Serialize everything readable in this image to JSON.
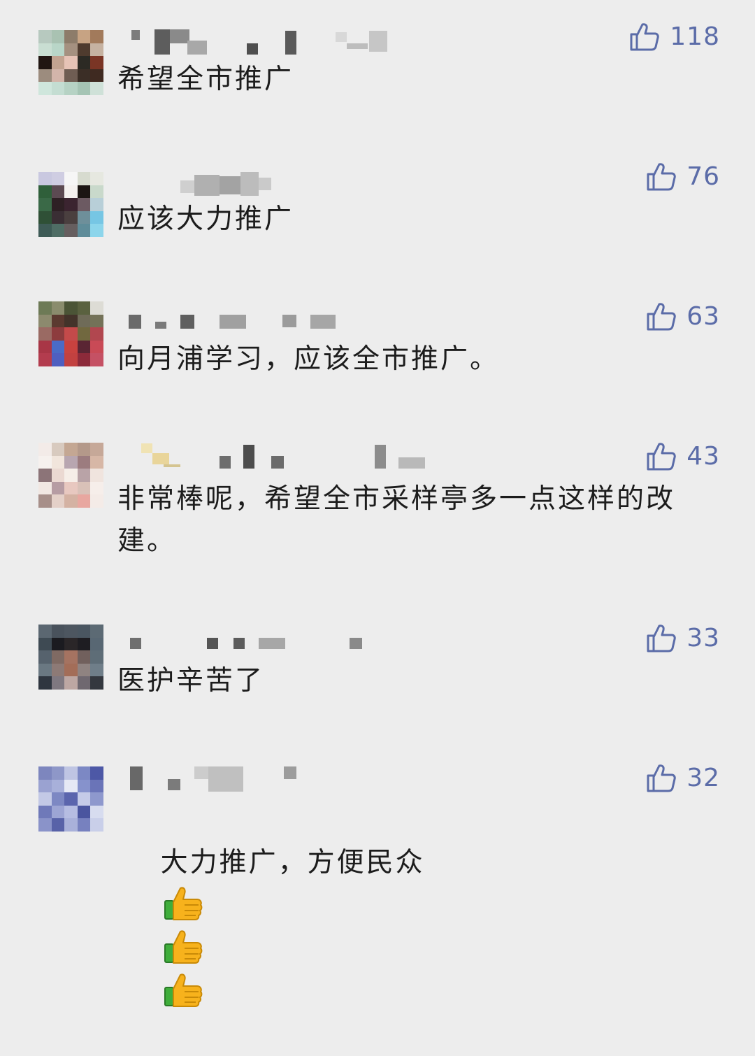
{
  "comments": [
    {
      "text": "希望全市推广",
      "likes": "118",
      "avatar": [
        "#b7c9bf",
        "#a9c2b2",
        "#8d7c6a",
        "#c7a383",
        "#a27a5b",
        "#c9ded2",
        "#b9d6c8",
        "#a59180",
        "#4f3b2e",
        "#c6b2a1",
        "#211612",
        "#c2a390",
        "#e6c3b6",
        "#2c2a24",
        "#7a3525",
        "#9c8c7e",
        "#d3b5aa",
        "#6f5d53",
        "#3b2e26",
        "#3f2a21",
        "#cfe6dc",
        "#c4ddd2",
        "#b6d2c4",
        "#a5c4b4",
        "#cfe1d8"
      ]
    },
    {
      "text": "应该大力推广",
      "likes": "76",
      "avatar": [
        "#c9c8e0",
        "#cfcde2",
        "#f6f6f6",
        "#d7dbcf",
        "#e6e8e0",
        "#2f5f3a",
        "#5c4a52",
        "#f4f1ef",
        "#1b1513",
        "#c9d9cb",
        "#3a6947",
        "#2e2024",
        "#3b2430",
        "#6c5a62",
        "#b8cfd8",
        "#2f5036",
        "#3a2e34",
        "#4a3f3f",
        "#6e8f9a",
        "#76c6e4",
        "#3e5b56",
        "#4f6d65",
        "#665e5f",
        "#5f8c99",
        "#8cd5eb"
      ]
    },
    {
      "text": "向月浦学习，应该全市推广。",
      "likes": "63",
      "avatar": [
        "#6d7a56",
        "#8a8c6d",
        "#4b5436",
        "#5a613f",
        "#dddcd5",
        "#8c8a6e",
        "#5b3a30",
        "#43332a",
        "#6f6b58",
        "#747258",
        "#9a6a63",
        "#8d3c3e",
        "#c44a4a",
        "#71683f",
        "#b1474f",
        "#a83646",
        "#4a6bc6",
        "#c8423f",
        "#5a2533",
        "#c94a56",
        "#b33c4e",
        "#4f5fc0",
        "#c24140",
        "#8c2a3a",
        "#c55164"
      ]
    },
    {
      "text": "非常棒呢，希望全市采样亭多一点这样的改建。",
      "likes": "43",
      "avatar": [
        "#f3ebe8",
        "#d8cabf",
        "#c4a793",
        "#b4998a",
        "#c6a898",
        "#f6f1ee",
        "#f1e5dc",
        "#b8a6b0",
        "#9c7c7f",
        "#d7b7a6",
        "#8c7478",
        "#ebd9d2",
        "#f6eee8",
        "#b9a3a7",
        "#f0e4de",
        "#f1e7e2",
        "#b69ca3",
        "#e8c8c0",
        "#d9c1b8",
        "#f6eeea",
        "#a78f89",
        "#e4d0c8",
        "#d4b2a3",
        "#e8a7a0",
        "#f4ebe7"
      ]
    },
    {
      "text": "医护辛苦了",
      "likes": "33",
      "avatar": [
        "#5b6771",
        "#49525c",
        "#4d5660",
        "#4a5661",
        "#5c6a74",
        "#3e4a53",
        "#1b1b20",
        "#2a2628",
        "#1e1d22",
        "#586773",
        "#56626d",
        "#7f6a63",
        "#a57361",
        "#71605d",
        "#5e6d77",
        "#6a7882",
        "#8d7a76",
        "#a36d58",
        "#8f8381",
        "#6f7e89",
        "#2f3640",
        "#7f7880",
        "#bda7a3",
        "#6f6870",
        "#34383f"
      ]
    },
    {
      "text": "大力推广，方便民众",
      "likes": "32",
      "avatar": [
        "#7d86be",
        "#8e97c8",
        "#bfc5e3",
        "#7c88c4",
        "#4d58a6",
        "#9aa2d1",
        "#a8b0da",
        "#e6e9f5",
        "#8692cc",
        "#6a74b8",
        "#c3c9e6",
        "#7d88c3",
        "#5b65ad",
        "#c5cbe8",
        "#8e98cd",
        "#6f79b9",
        "#9da5d4",
        "#b6bde2",
        "#4a559f",
        "#d7dcef",
        "#8a93c9",
        "#5862a8",
        "#a9b1da",
        "#7781bf",
        "#c9cfe9"
      ]
    }
  ],
  "colors": {
    "background": "#ededed",
    "like_accent": "#5b6ca8",
    "text": "#1c1c1c"
  },
  "icons": {
    "like": "thumbs-up-outline-icon",
    "emoji": "thumbs-up-emoji-icon"
  }
}
